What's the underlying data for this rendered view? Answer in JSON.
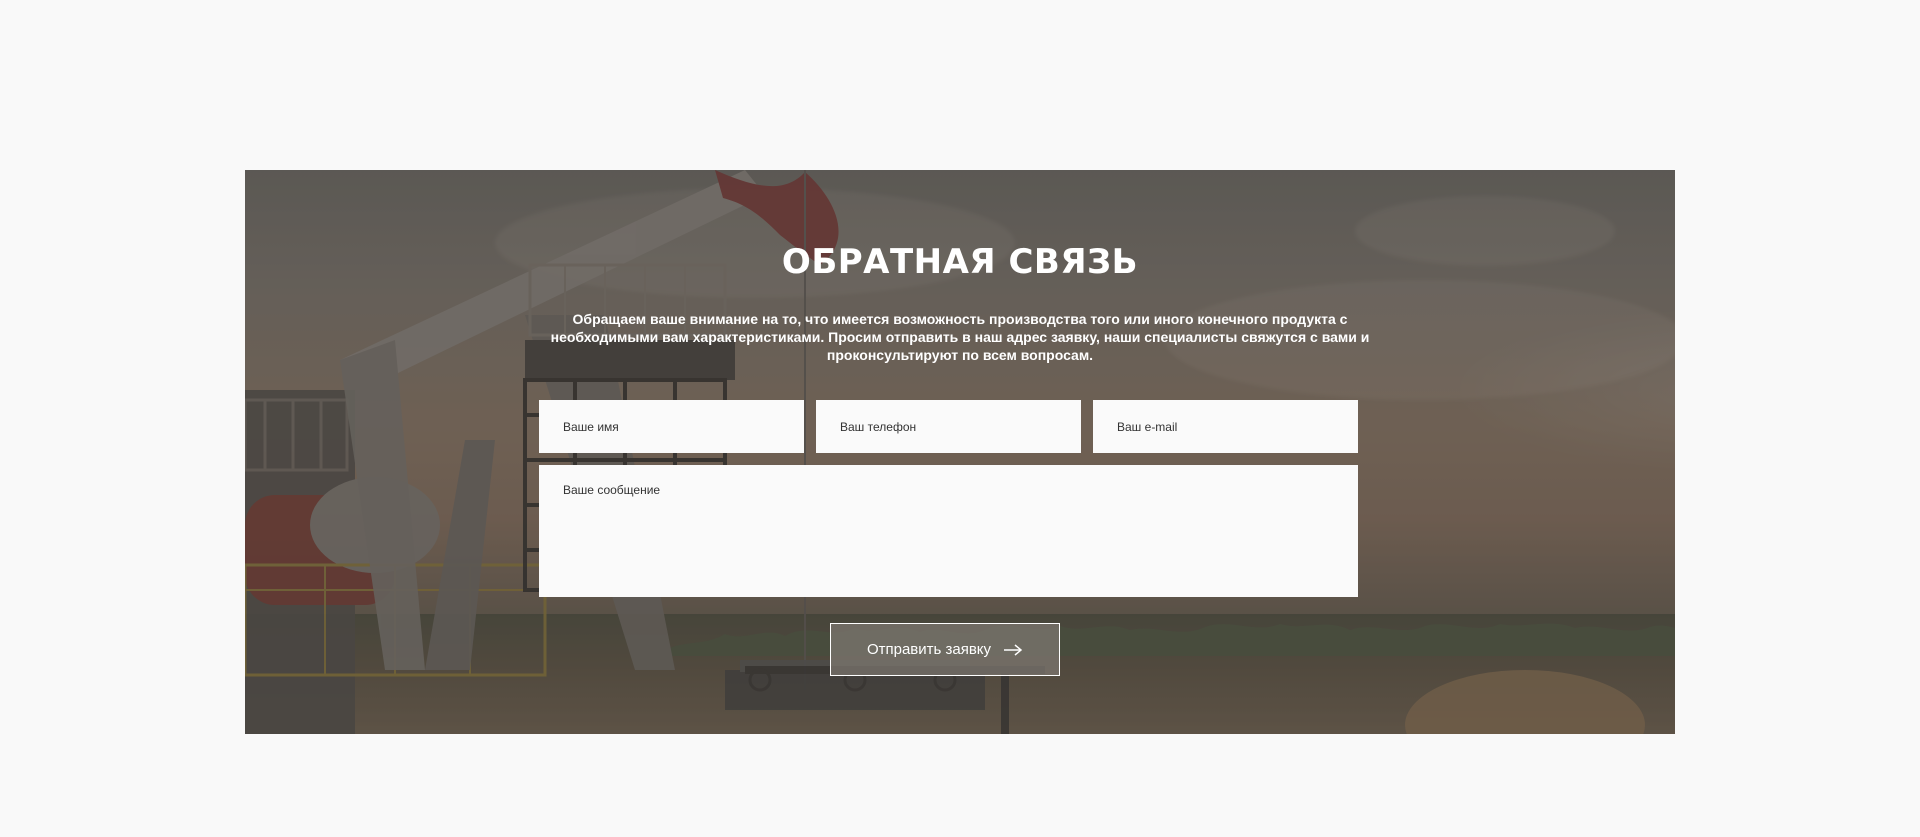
{
  "section": {
    "title": "ОБРАТНАЯ СВЯЗЬ",
    "subtitle": "Обращаем ваше внимание на то, что имеется возможность производства того или иного конечного продукта с необходимыми вам характеристиками. Просим отправить в наш адрес заявку, наши специалисты свяжутся с вами и проконсультируют по всем вопросам."
  },
  "form": {
    "name_placeholder": "Ваше имя",
    "phone_placeholder": "Ваш телефон",
    "email_placeholder": "Ваш e-mail",
    "message_placeholder": "Ваше сообщение",
    "submit_label": "Отправить заявку"
  },
  "icons": {
    "submit": "arrow-right-icon"
  },
  "colors": {
    "page_background": "#f9f9f9",
    "overlay": "#6a625b",
    "field_background": "#fafafa",
    "text_light": "#ffffff"
  }
}
